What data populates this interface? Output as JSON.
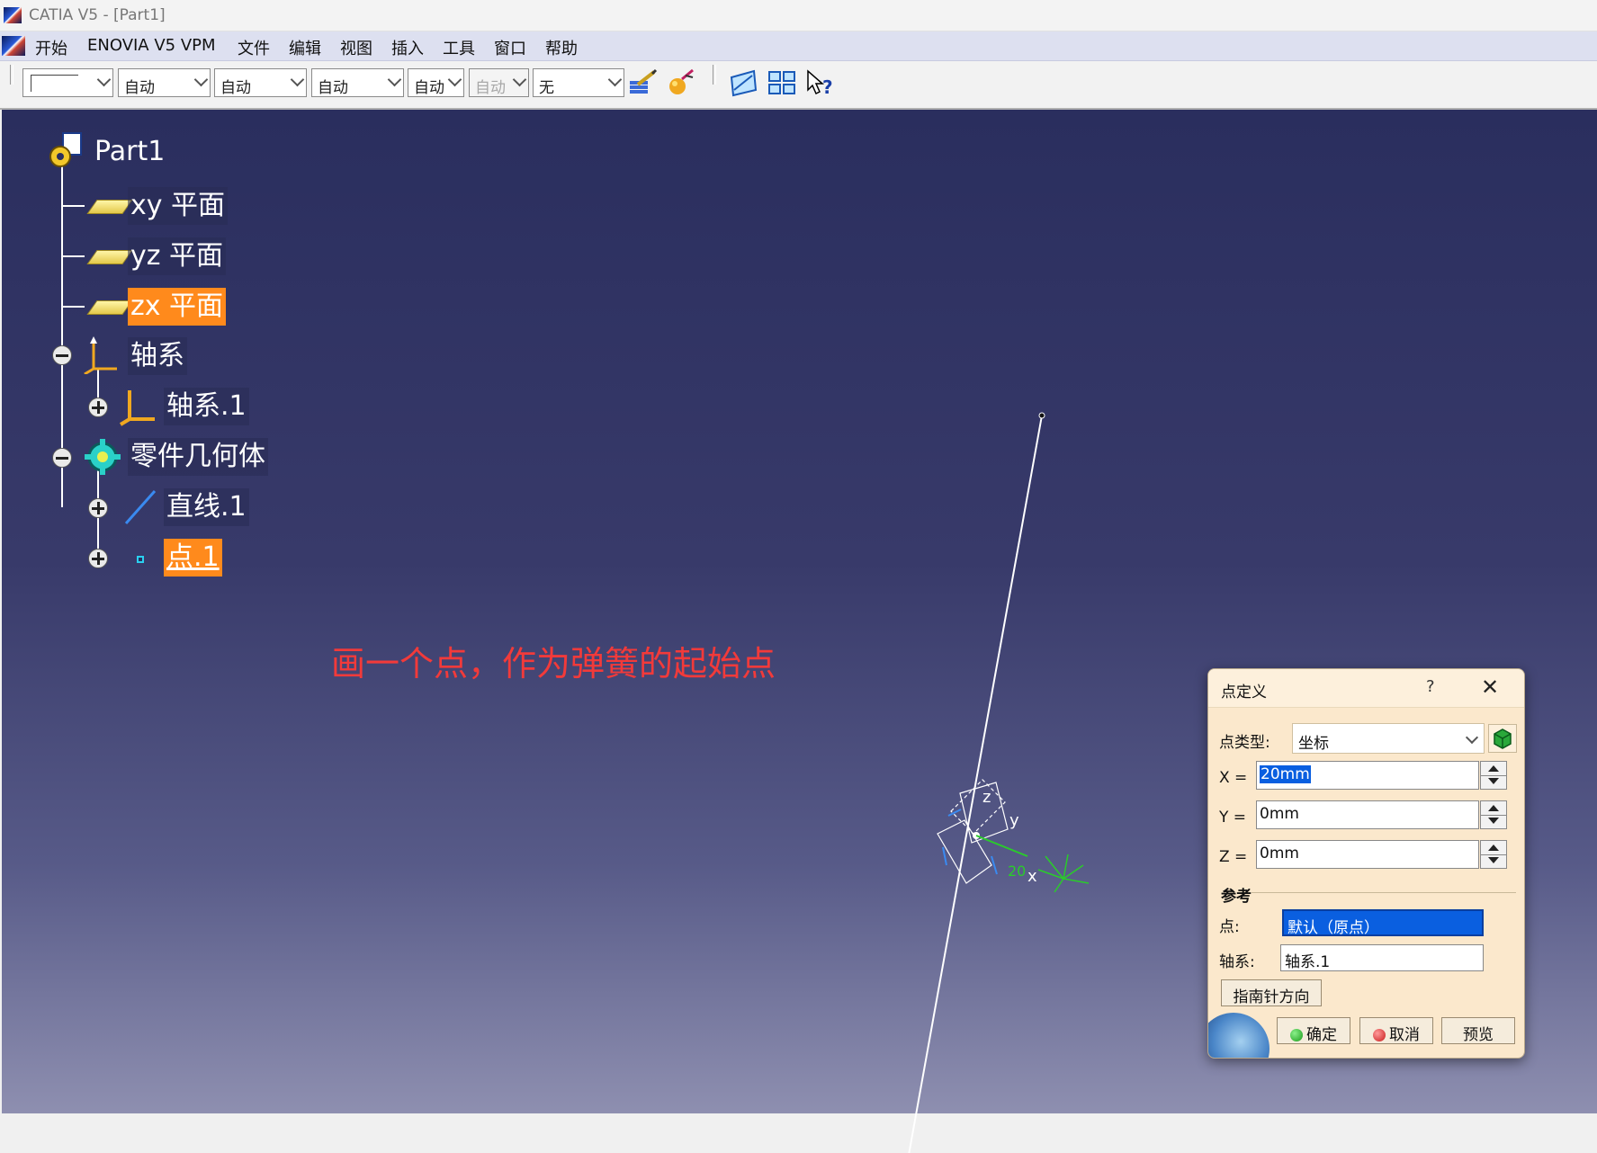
{
  "window": {
    "title": "CATIA V5 - [Part1]"
  },
  "menu": {
    "items": [
      "开始",
      "ENOVIA V5 VPM",
      "文件",
      "编辑",
      "视图",
      "插入",
      "工具",
      "窗口",
      "帮助"
    ]
  },
  "toolbar": {
    "combos": [
      {
        "value": ""
      },
      {
        "value": "自动"
      },
      {
        "value": "自动"
      },
      {
        "value": "自动"
      },
      {
        "value": "自动"
      },
      {
        "value": "自动"
      },
      {
        "value": "无"
      }
    ]
  },
  "tree": {
    "root": "Part1",
    "xy_plane": "xy 平面",
    "yz_plane": "yz 平面",
    "zx_plane": "zx 平面",
    "axis_systems": "轴系",
    "axis_system_1": "轴系.1",
    "part_body": "零件几何体",
    "line_1": "直线.1",
    "point_1": "点.1"
  },
  "annotation": "画一个点，作为弹簧的起始点",
  "compass": {
    "z": "z",
    "y": "y",
    "x": "x",
    "dim": "20"
  },
  "dialog": {
    "title": "点定义",
    "help": "?",
    "close": "✕",
    "point_type_label": "点类型:",
    "point_type_value": "坐标",
    "x_label": "X =",
    "x_value": "20mm",
    "y_label": "Y =",
    "y_value": "0mm",
    "z_label": "Z =",
    "z_value": "0mm",
    "reference_label": "参考",
    "point_label": "点:",
    "point_value": "默认（原点）",
    "axis_label": "轴系:",
    "axis_value": "轴系.1",
    "compass_button": "指南针方向",
    "ok_button": "确定",
    "cancel_button": "取消",
    "preview_button": "预览"
  },
  "colors": {
    "selection": "#ff8a1c",
    "annotation": "#f23a3a",
    "viewport_top": "#2a2e5e",
    "viewport_bottom": "#8e8fb0",
    "dialog_bg": "#fbe8cc"
  }
}
